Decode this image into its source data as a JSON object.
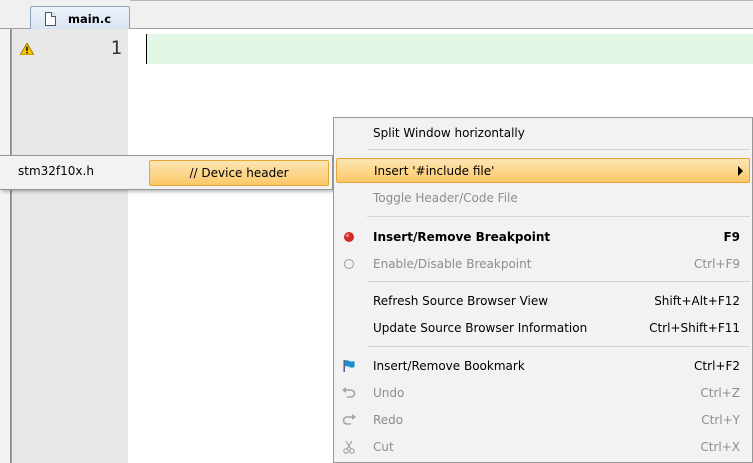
{
  "tab": {
    "label": "main.c",
    "icon": "file-icon"
  },
  "editor": {
    "line_numbers": [
      "1"
    ],
    "gutter_icons": [
      "warning-icon"
    ],
    "current_line_color": "#e3f7e6"
  },
  "context_menu": {
    "items": [
      {
        "label": "Split Window horizontally",
        "shortcut": "",
        "enabled": true,
        "bold": false,
        "icon": ""
      },
      {
        "label": "Insert '#include file'",
        "shortcut": "",
        "enabled": true,
        "bold": false,
        "icon": "",
        "has_submenu": true,
        "highlighted": true
      },
      {
        "label": "Toggle Header/Code File",
        "shortcut": "",
        "enabled": false,
        "bold": false,
        "icon": ""
      },
      {
        "label": "Insert/Remove Breakpoint",
        "shortcut": "F9",
        "enabled": true,
        "bold": true,
        "icon": "breakpoint-icon"
      },
      {
        "label": "Enable/Disable Breakpoint",
        "shortcut": "Ctrl+F9",
        "enabled": false,
        "bold": false,
        "icon": "breakpoint-outline-icon"
      },
      {
        "label": "Refresh Source Browser View",
        "shortcut": "Shift+Alt+F12",
        "enabled": true,
        "bold": false,
        "icon": ""
      },
      {
        "label": "Update Source Browser Information",
        "shortcut": "Ctrl+Shift+F11",
        "enabled": true,
        "bold": false,
        "icon": ""
      },
      {
        "label": "Insert/Remove Bookmark",
        "shortcut": "Ctrl+F2",
        "enabled": true,
        "bold": false,
        "icon": "bookmark-flag-icon"
      },
      {
        "label": "Undo",
        "shortcut": "Ctrl+Z",
        "enabled": false,
        "bold": false,
        "icon": "undo-icon"
      },
      {
        "label": "Redo",
        "shortcut": "Ctrl+Y",
        "enabled": false,
        "bold": false,
        "icon": "redo-icon"
      },
      {
        "label": "Cut",
        "shortcut": "Ctrl+X",
        "enabled": false,
        "bold": false,
        "icon": "scissors-icon"
      }
    ]
  },
  "submenu": {
    "file": "stm32f10x.h",
    "item": "// Device header"
  },
  "colors": {
    "highlight": "#fbc867",
    "breakpoint": "#d42a2a",
    "bookmark": "#1a8fd0"
  }
}
